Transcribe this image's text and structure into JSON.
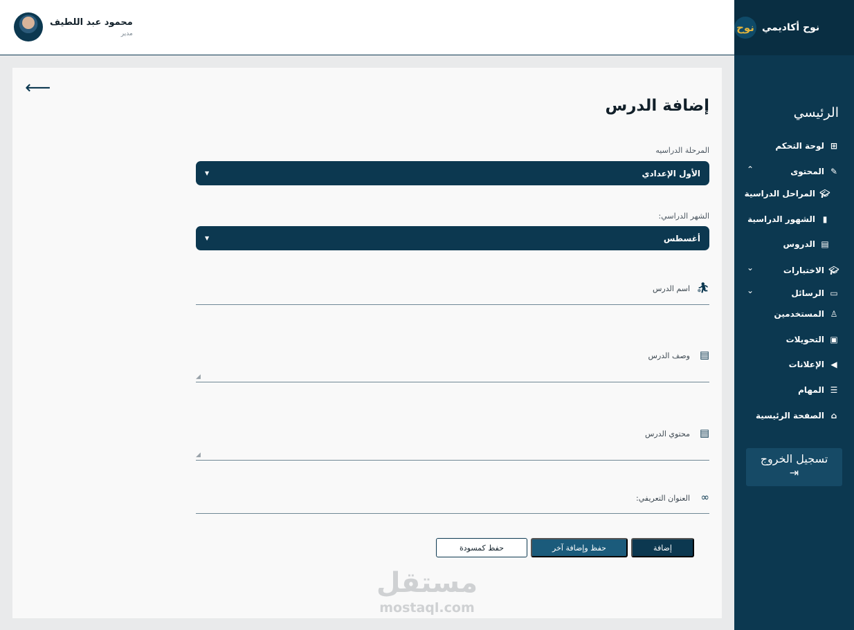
{
  "brand": {
    "name": "نوح أكاديمي",
    "logo_text": "نوح"
  },
  "sidebar": {
    "home_heading": "الرئيسي",
    "items": [
      {
        "label": "لوحة التحكم",
        "icon": "grid-icon"
      },
      {
        "label": "المحتوى",
        "icon": "pencil-icon"
      },
      {
        "label": "المراحل الدراسية",
        "icon": "graduation-cap-icon"
      },
      {
        "label": "الشهور الدراسية",
        "icon": "bookmark-icon"
      },
      {
        "label": "الدروس",
        "icon": "file-icon"
      },
      {
        "label": "الاختبارات",
        "icon": "graduation-cap-icon"
      },
      {
        "label": "الرسائل",
        "icon": "message-icon"
      },
      {
        "label": "المستخدمين",
        "icon": "user-icon"
      },
      {
        "label": "التحويلات",
        "icon": "money-icon"
      },
      {
        "label": "الإعلانات",
        "icon": "megaphone-icon"
      },
      {
        "label": "المهام",
        "icon": "tasks-icon"
      },
      {
        "label": "الصفحة الرئيسية",
        "icon": "home-icon"
      }
    ],
    "logout_label": "تسجيل الخروج"
  },
  "header": {
    "user_name": "محمود عبد اللطيف",
    "user_role": "مدير"
  },
  "form": {
    "title": "إضافة الدرس",
    "stage_label": "المرحلة الدراسيه",
    "stage_value": "الأول الإعدادي",
    "month_label": "الشهر الدراسي:",
    "month_value": "أغسطس",
    "lesson_name_label": "اسم الدرس",
    "lesson_desc_label": "وصف الدرس",
    "lesson_content_label": "محتوي الدرس",
    "url_label": "العنوان التعريفي:",
    "btn_add": "إضافة",
    "btn_save_add": "حفظ وإضافة آخر",
    "btn_draft": "حفظ كمسودة"
  },
  "watermark": {
    "ar": "مستقل",
    "en": "mostaql.com"
  },
  "colors": {
    "primary": "#0c3850",
    "accent": "#1b5b7b",
    "logo_gold": "#e2b53e"
  }
}
